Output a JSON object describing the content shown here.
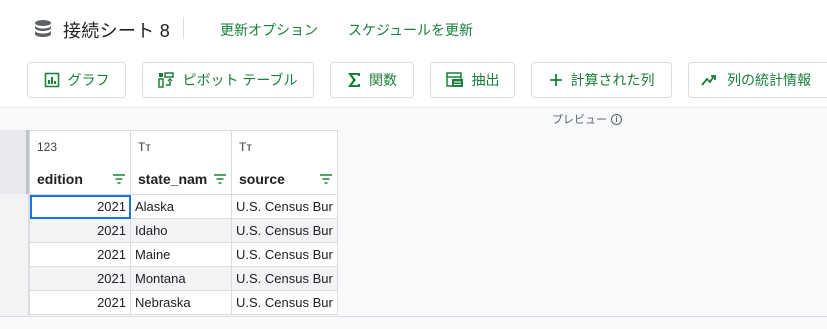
{
  "header": {
    "title": "接続シート 8",
    "links": {
      "refresh_options": "更新オプション",
      "schedule_refresh": "スケジュールを更新"
    }
  },
  "toolbar": {
    "chart": "グラフ",
    "pivot": "ピボット テーブル",
    "function": "関数",
    "extract": "抽出",
    "calculated_column": "計算された列",
    "column_stats": "列の統計情報"
  },
  "preview": {
    "label": "プレビュー"
  },
  "table": {
    "columns": [
      {
        "type": "123",
        "name": "edition"
      },
      {
        "type": "Tт",
        "name": "state_nam"
      },
      {
        "type": "Tт",
        "name": "source"
      }
    ],
    "rows": [
      [
        "2021",
        "Alaska",
        "U.S. Census Bur"
      ],
      [
        "2021",
        "Idaho",
        "U.S. Census Bur"
      ],
      [
        "2021",
        "Maine",
        "U.S. Census Bur"
      ],
      [
        "2021",
        "Montana",
        "U.S. Census Bur"
      ],
      [
        "2021",
        "Nebraska",
        "U.S. Census Bur"
      ]
    ]
  },
  "colors": {
    "accent_green": "#188038",
    "selection_blue": "#1a73e8",
    "border": "#dadce0"
  }
}
